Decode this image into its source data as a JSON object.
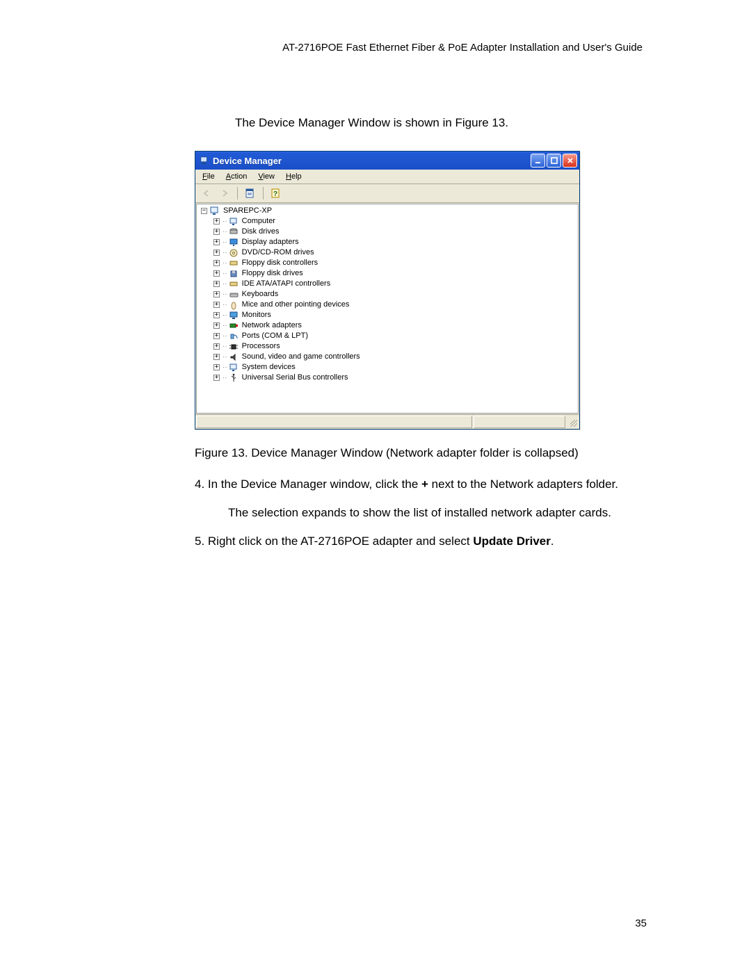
{
  "header": "AT-2716POE Fast Ethernet Fiber & PoE Adapter Installation and User's Guide",
  "intro": "The Device Manager Window is shown in Figure 13.",
  "figure_caption": "Figure 13. Device Manager Window (Network adapter folder is collapsed)",
  "step4_prefix": "4.  In the Device Manager window, click the ",
  "step4_bold": "+",
  "step4_suffix": " next to the Network adapters folder.",
  "step4_sub": "The selection expands to show the list of installed network adapter cards.",
  "step5_prefix": "5.  Right click on the AT-2716POE adapter and select ",
  "step5_bold": "Update Driver",
  "step5_suffix": ".",
  "page_number": "35",
  "dm": {
    "title": "Device Manager",
    "menu": {
      "file": "File",
      "action": "Action",
      "view": "View",
      "help": "Help"
    },
    "toolbar_icons": {
      "back": "back-arrow-icon",
      "forward": "forward-arrow-icon",
      "properties": "properties-icon",
      "help": "help-icon"
    },
    "root": "SPAREPC-XP",
    "nodes": [
      "Computer",
      "Disk drives",
      "Display adapters",
      "DVD/CD-ROM drives",
      "Floppy disk controllers",
      "Floppy disk drives",
      "IDE ATA/ATAPI controllers",
      "Keyboards",
      "Mice and other pointing devices",
      "Monitors",
      "Network adapters",
      "Ports (COM & LPT)",
      "Processors",
      "Sound, video and game controllers",
      "System devices",
      "Universal Serial Bus controllers"
    ]
  }
}
